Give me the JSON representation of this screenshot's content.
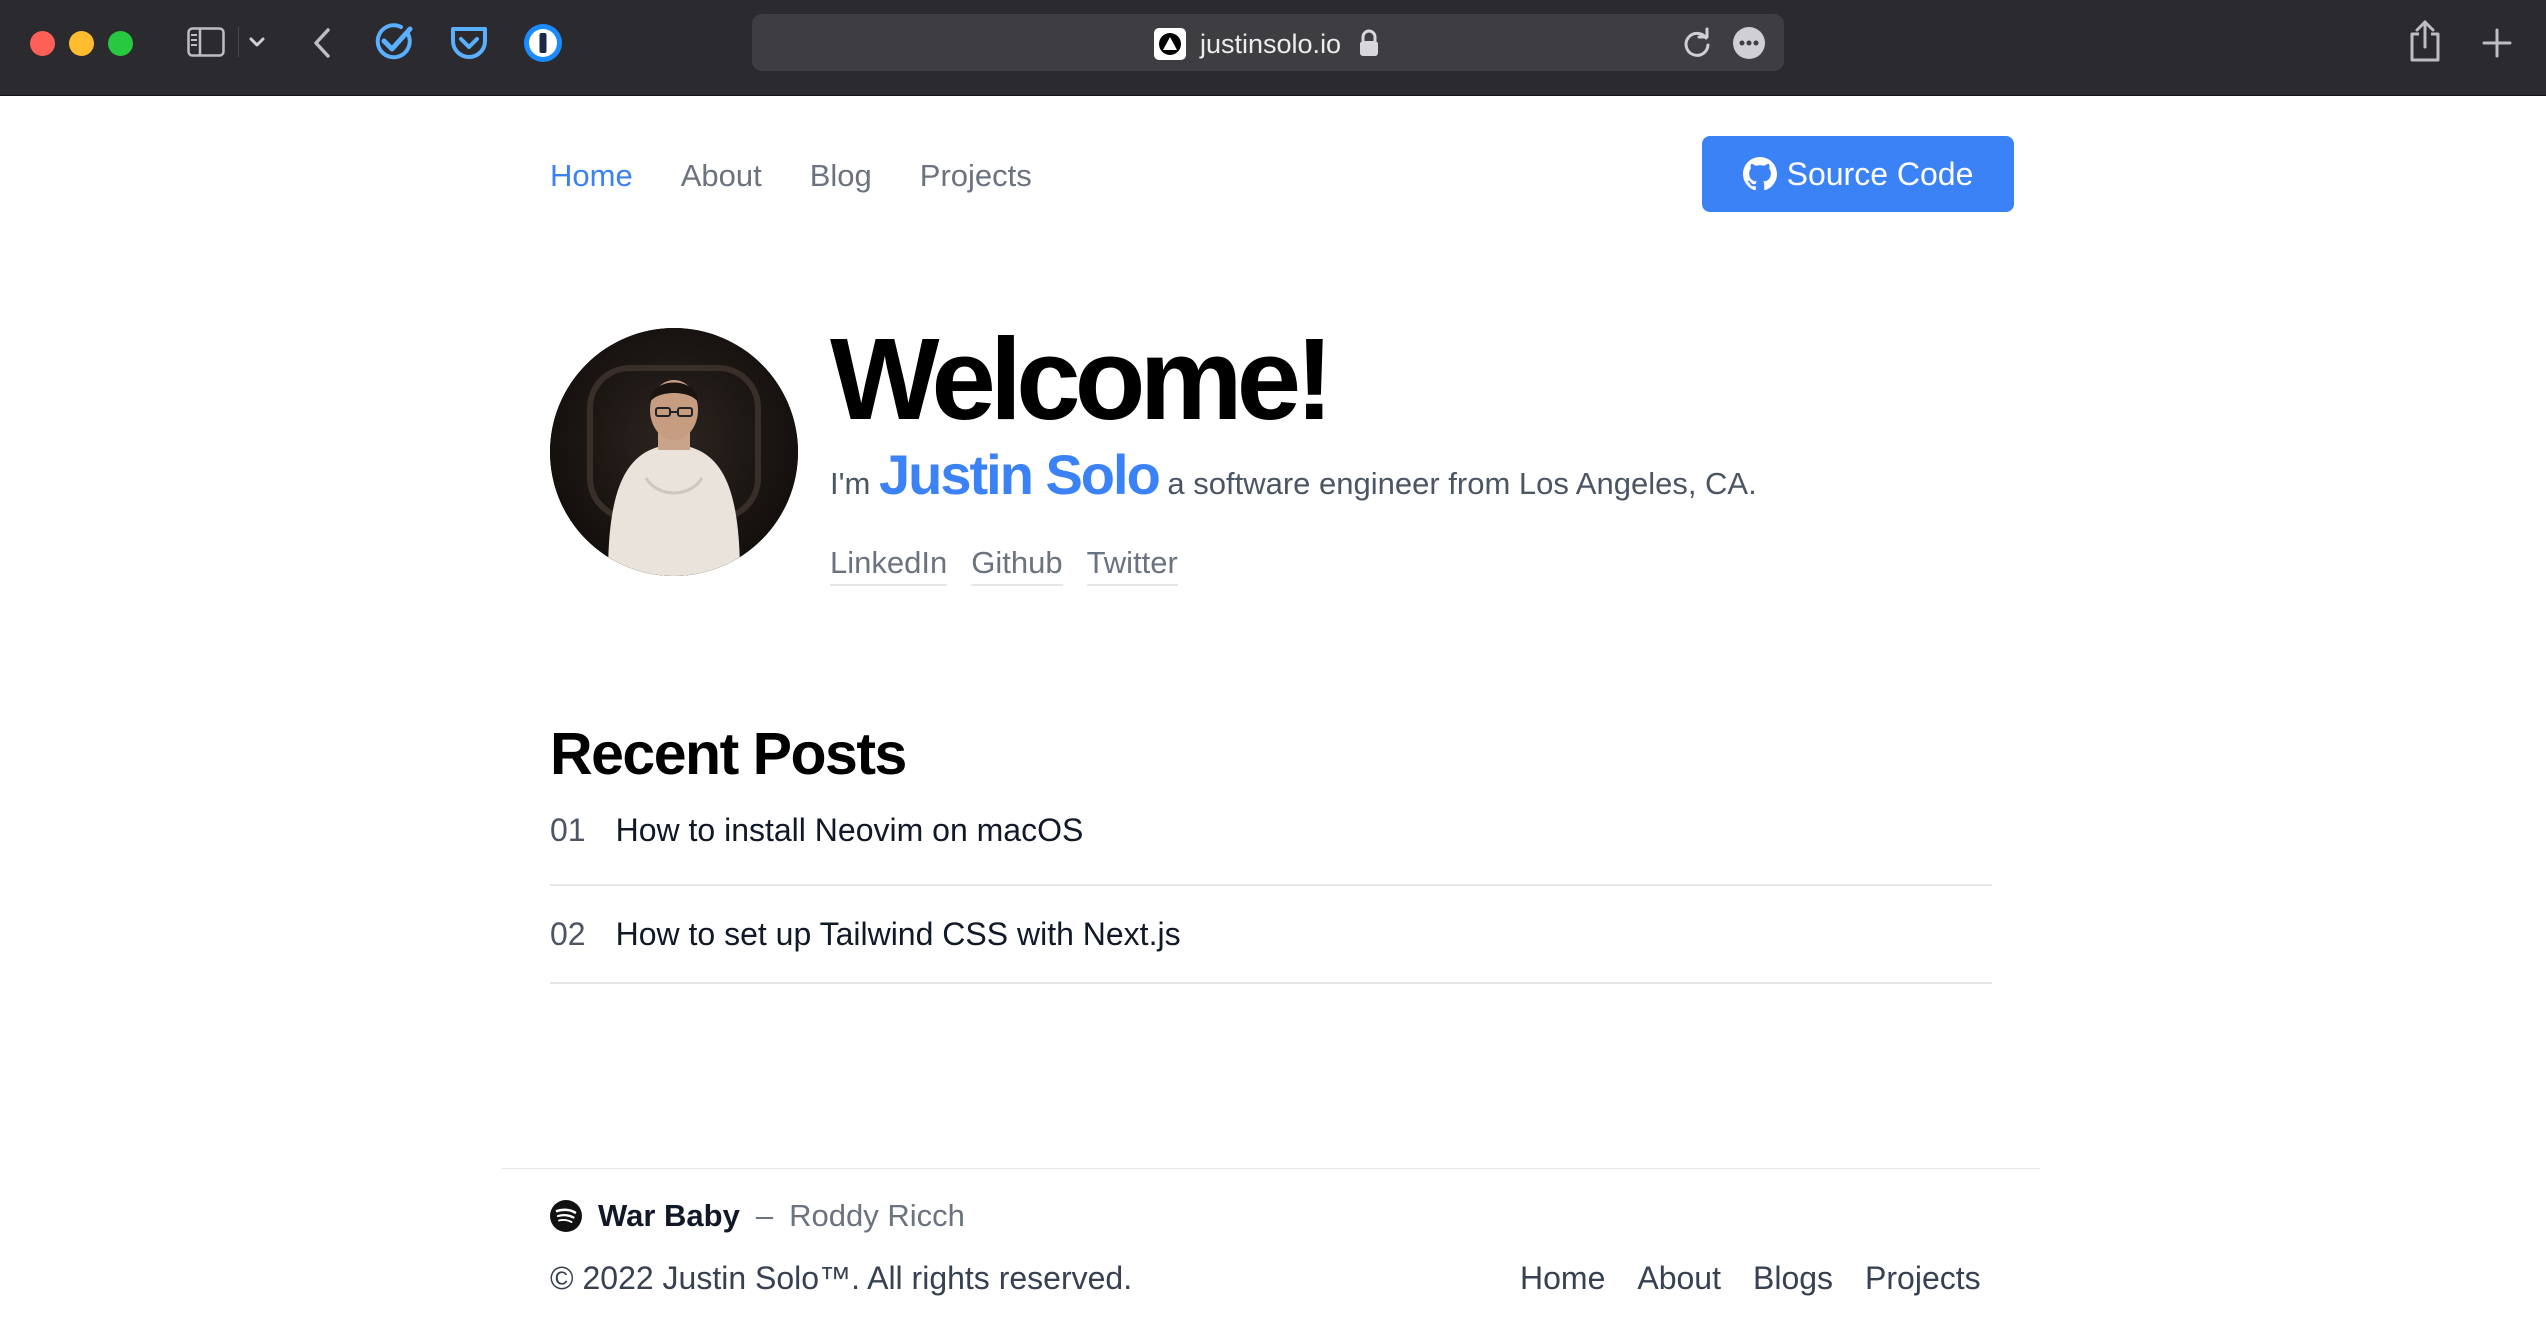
{
  "browser": {
    "url": "justinsolo.io"
  },
  "nav": {
    "items": [
      "Home",
      "About",
      "Blog",
      "Projects"
    ],
    "active": "Home",
    "source_button": "Source Code"
  },
  "hero": {
    "title": "Welcome!",
    "intro_prefix": "I'm",
    "name": "Justin Solo",
    "intro_suffix": "a software engineer from Los Angeles, CA.",
    "links": [
      "LinkedIn",
      "Github",
      "Twitter"
    ]
  },
  "recent": {
    "title": "Recent Posts",
    "posts": [
      {
        "num": "01",
        "title": "How to install Neovim on macOS"
      },
      {
        "num": "02",
        "title": "How to set up Tailwind CSS with Next.js"
      }
    ]
  },
  "footer": {
    "song": "War Baby",
    "separator": "–",
    "artist": "Roddy Ricch",
    "copyright": "© 2022  Justin Solo™. All rights reserved.",
    "links": [
      "Home",
      "About",
      "Blogs",
      "Projects"
    ]
  },
  "colors": {
    "accent": "#3b82f6",
    "chrome": "#2b2b2f",
    "urlbar": "#3e3e42",
    "muted_text": "#6b7280"
  },
  "icons": [
    "sidebar-icon",
    "chevron-down-icon",
    "back-arrow-icon",
    "checkmark-extension-icon",
    "pocket-icon",
    "onepassword-icon",
    "vercel-triangle-icon",
    "lock-icon",
    "reload-icon",
    "more-icon",
    "share-icon",
    "plus-icon",
    "github-icon",
    "spotify-icon"
  ]
}
